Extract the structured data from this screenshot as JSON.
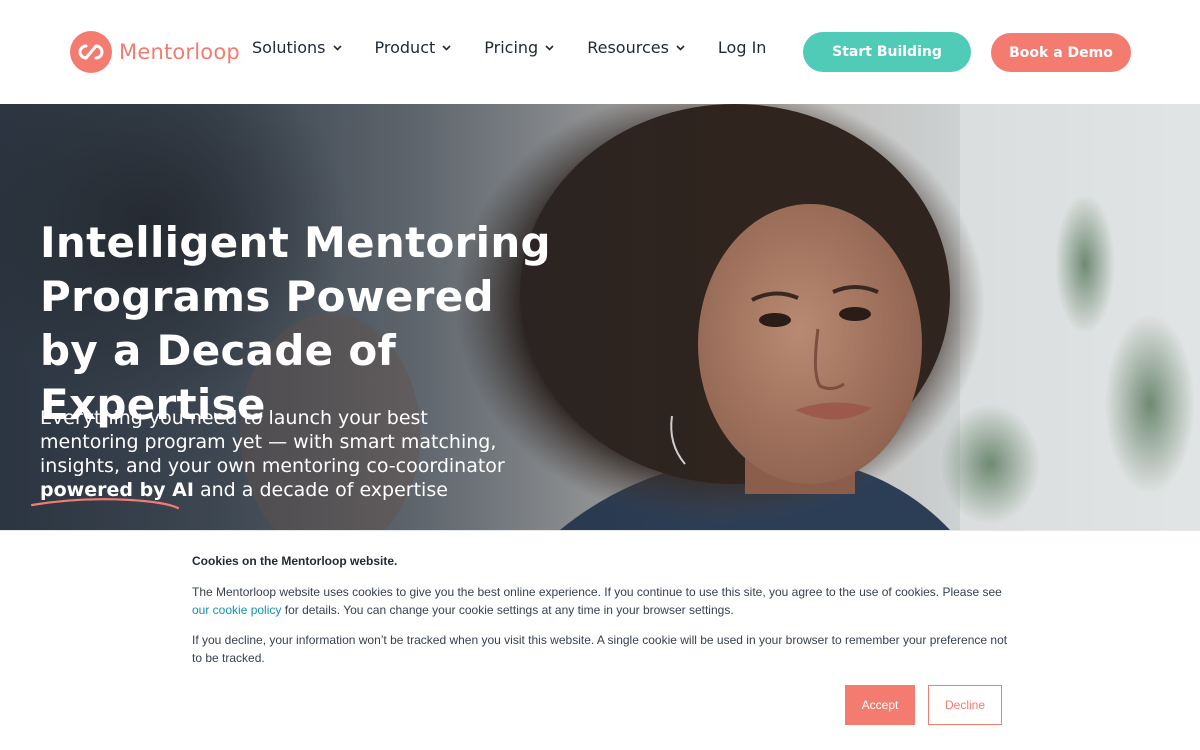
{
  "brand": {
    "name": "Mentorloop",
    "accent": "#f47b6f",
    "secondary": "#4fcbb8"
  },
  "nav": {
    "items": [
      {
        "label": "Solutions",
        "has_dropdown": true
      },
      {
        "label": "Product",
        "has_dropdown": true
      },
      {
        "label": "Pricing",
        "has_dropdown": true
      },
      {
        "label": "Resources",
        "has_dropdown": true
      },
      {
        "label": "Log In",
        "has_dropdown": false
      }
    ],
    "start_label": "Start Building",
    "demo_label": "Book a Demo"
  },
  "hero": {
    "title": "Intelligent Mentoring Programs Powered by a Decade of Expertise",
    "subtitle_start": "Everything you need to launch your best mentoring program yet — with smart matching, insights, and your own mentoring co-coordinator",
    "subtitle_bold": "powered by AI",
    "subtitle_end": "and a decade of expertise"
  },
  "cookie": {
    "title": "Cookies on the Mentorloop website.",
    "p1_start": "The Mentorloop website uses cookies to give you the best online experience. If you continue to use this site, you agree to the use of cookies. Please see",
    "p1_link": "our cookie policy",
    "p1_end": "for details. You can change your cookie settings at any time in your browser settings.",
    "p2": "If you decline, your information won’t be tracked when you visit this website. A single cookie will be used in your browser to remember your preference not to be tracked.",
    "accept_label": "Accept",
    "decline_label": "Decline"
  },
  "icons": [
    "logo-mark-icon",
    "chevron-down-icon"
  ]
}
